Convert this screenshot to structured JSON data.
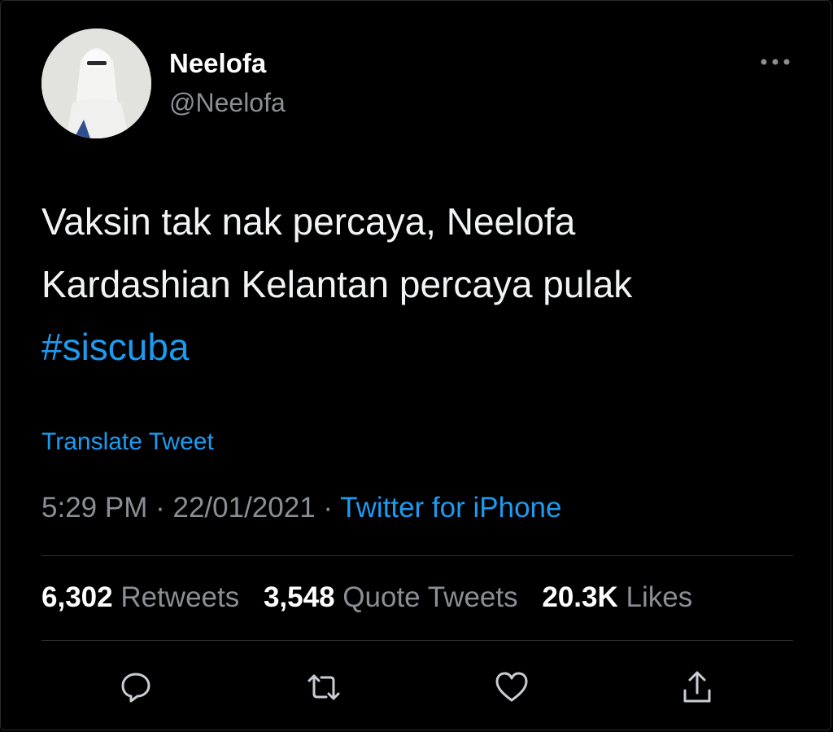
{
  "tweet": {
    "author": {
      "display_name": "Neelofa",
      "handle": "@Neelofa"
    },
    "text_lines": [
      "Vaksin tak nak percaya, Neelofa",
      "Kardashian Kelantan percaya pulak"
    ],
    "hashtag": "#siscuba",
    "translate_label": "Translate Tweet",
    "time": "5:29 PM",
    "separator": "·",
    "date": "22/01/2021",
    "source": "Twitter for iPhone",
    "stats": {
      "retweets_count": "6,302",
      "retweets_label": "Retweets",
      "quote_tweets_count": "3,548",
      "quote_tweets_label": "Quote Tweets",
      "likes_count": "20.3K",
      "likes_label": "Likes"
    }
  },
  "icons": {
    "more": "more-dots-icon",
    "reply": "reply-icon",
    "retweet": "retweet-icon",
    "like": "heart-icon",
    "share": "share-icon"
  },
  "colors": {
    "background": "#000000",
    "text": "#f2f3f4",
    "muted": "#8b8f94",
    "accent": "#1d9bf0",
    "divider": "#2f3336"
  }
}
